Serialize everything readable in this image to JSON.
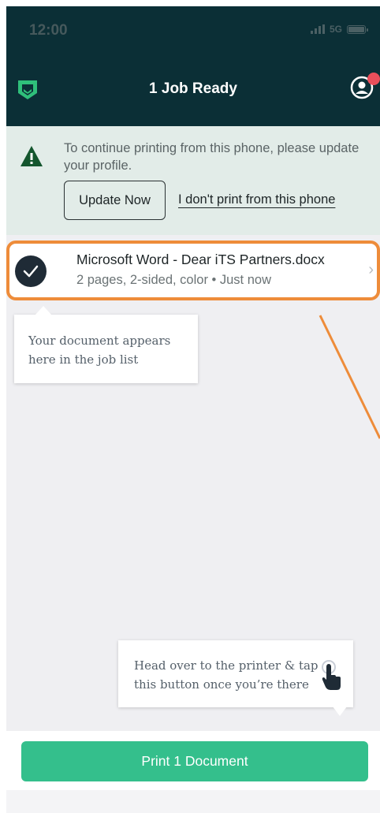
{
  "status_bar": {
    "time": "12:00",
    "network": "5G"
  },
  "header": {
    "title": "1 Job Ready"
  },
  "banner": {
    "message": "To continue printing from this phone, please update your profile.",
    "update_label": "Update Now",
    "no_print_label": "I don't print from this phone"
  },
  "job": {
    "title": "Microsoft Word - Dear iTS Partners.docx",
    "meta": "2 pages, 2-sided, color • Just now"
  },
  "tooltips": {
    "job_list": "Your document appears\nhere in the job list",
    "printer": "Head over to the printer & tap\nthis button once you’re there"
  },
  "footer": {
    "print_label": "Print 1 Document"
  },
  "colors": {
    "header_bg": "#0b2f36",
    "banner_bg": "#e2ece8",
    "accent_green": "#34bf8c",
    "highlight_orange": "#ee8c3a",
    "notification_red": "#e94f5b"
  },
  "icons": {
    "logo": "shield-logo-icon",
    "profile": "profile-icon",
    "warning": "warning-icon",
    "check": "check-icon",
    "chevron": "chevron-right-icon",
    "tap": "tap-hand-icon"
  }
}
